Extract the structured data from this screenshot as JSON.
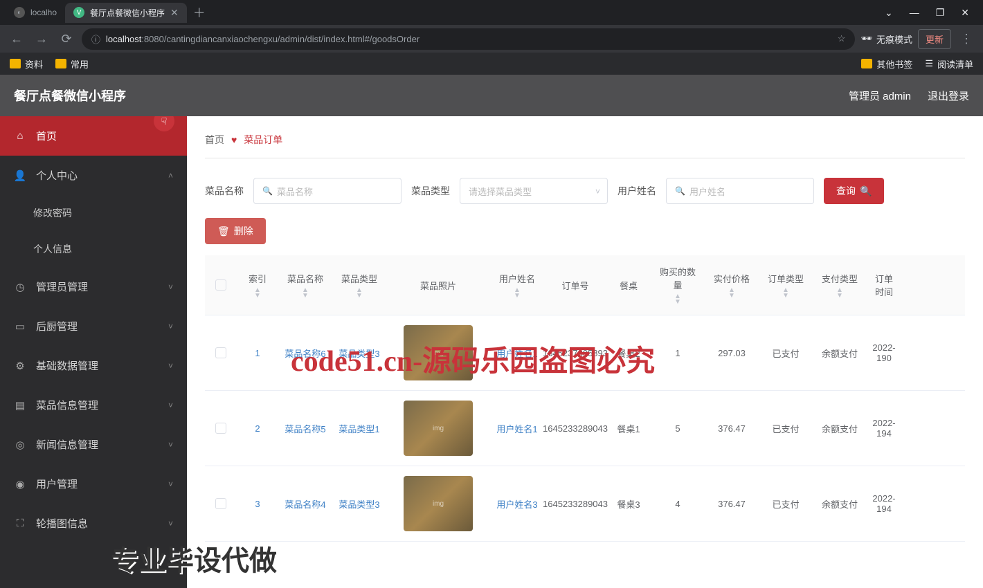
{
  "browser": {
    "tabs": [
      {
        "favicon": "◐",
        "label": "localho"
      },
      {
        "favicon": "V",
        "label": "餐厅点餐微信小程序"
      }
    ],
    "win_ctrl": {
      "min": "⌄",
      "max": "—",
      "restore": "❐",
      "close": "✕"
    },
    "nav": {
      "back": "←",
      "forward": "→",
      "reload": "⟳"
    },
    "url_icon": "ⓘ",
    "url_host": "localhost",
    "url_rest": ":8080/cantingdiancanxiaochengxu/admin/dist/index.html#/goodsOrder",
    "star": "☆",
    "incognito_label": "无痕模式",
    "update_label": "更新",
    "update_arrow": "⋮",
    "bookmarks": [
      {
        "label": "资料"
      },
      {
        "label": "常用"
      }
    ],
    "bm_right": [
      {
        "label": "其他书签"
      },
      {
        "icon": "☰",
        "label": "阅读清单"
      }
    ]
  },
  "header": {
    "title": "餐厅点餐微信小程序",
    "admin": "管理员 admin",
    "logout": "退出登录"
  },
  "sidebar": {
    "items": [
      {
        "icon": "⌂",
        "label": "首页",
        "active": true
      },
      {
        "icon": "👤",
        "label": "个人中心",
        "expand": true
      },
      {
        "sub": true,
        "label": "修改密码"
      },
      {
        "sub": true,
        "label": "个人信息"
      },
      {
        "icon": "◷",
        "label": "管理员管理",
        "expand": true
      },
      {
        "icon": "▭",
        "label": "后厨管理",
        "expand": true
      },
      {
        "icon": "⚙",
        "label": "基础数据管理",
        "expand": true
      },
      {
        "icon": "▤",
        "label": "菜品信息管理",
        "expand": true
      },
      {
        "icon": "◎",
        "label": "新闻信息管理",
        "expand": true
      },
      {
        "icon": "◉",
        "label": "用户管理",
        "expand": true
      },
      {
        "icon": "⛶",
        "label": "轮播图信息",
        "expand": true
      }
    ]
  },
  "breadcrumb": {
    "home": "首页",
    "current": "菜品订单"
  },
  "search": {
    "f1_label": "菜品名称",
    "f1_ph": "菜品名称",
    "f2_label": "菜品类型",
    "f2_ph": "请选择菜品类型",
    "f3_label": "用户姓名",
    "f3_ph": "用户姓名",
    "btn_query": "查询",
    "btn_delete": "删除"
  },
  "table": {
    "headers": {
      "idx": "索引",
      "name": "菜品名称",
      "type": "菜品类型",
      "img": "菜品照片",
      "user": "用户姓名",
      "order": "订单号",
      "tbl": "餐桌",
      "qty": "购买的数量",
      "price": "实付价格",
      "otype": "订单类型",
      "ptype": "支付类型",
      "time": "订单时间"
    },
    "rows": [
      {
        "idx": "1",
        "name": "菜品名称6",
        "type": "菜品类型3",
        "user": "用户姓名1",
        "order": "1645237805893",
        "tbl": "餐桌2",
        "qty": "1",
        "price": "297.03",
        "otype": "已支付",
        "ptype": "余额支付",
        "time": "2022-190"
      },
      {
        "idx": "2",
        "name": "菜品名称5",
        "type": "菜品类型1",
        "user": "用户姓名1",
        "order": "1645233289043",
        "tbl": "餐桌1",
        "qty": "5",
        "price": "376.47",
        "otype": "已支付",
        "ptype": "余额支付",
        "time": "2022-194"
      },
      {
        "idx": "3",
        "name": "菜品名称4",
        "type": "菜品类型3",
        "user": "用户姓名3",
        "order": "1645233289043",
        "tbl": "餐桌3",
        "qty": "4",
        "price": "376.47",
        "otype": "已支付",
        "ptype": "余额支付",
        "time": "2022-194"
      }
    ]
  },
  "watermark": {
    "main": "code51.cn-源码乐园盗图必究",
    "bottom": "专业毕设代做",
    "ghost": "code51.cn"
  }
}
